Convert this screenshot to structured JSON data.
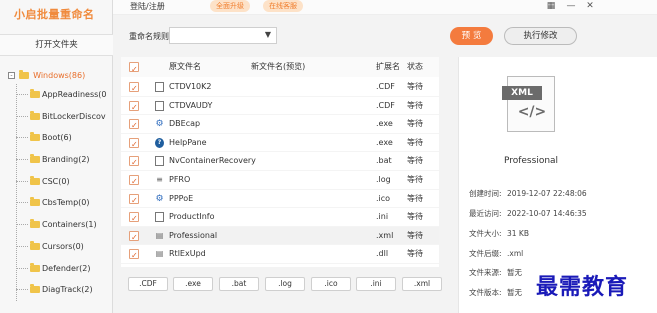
{
  "app": {
    "logo_text": "小启批量重命名",
    "login": "登陆/注册",
    "pills": [
      "全面升级",
      "在线客服"
    ]
  },
  "window_controls": {
    "grid": "▦",
    "minimize": "—",
    "close": "✕"
  },
  "sidebar": {
    "open_folder": "打开文件夹",
    "root": {
      "toggle": "-",
      "label": "Windows(86)"
    },
    "items": [
      "AppReadiness(0",
      "BitLockerDiscov",
      "Boot(6)",
      "Branding(2)",
      "CSC(0)",
      "CbsTemp(0)",
      "Containers(1)",
      "Cursors(0)",
      "Defender(2)",
      "DiagTrack(2)"
    ]
  },
  "toolbar": {
    "rule_label": "重命名规则",
    "rule_value": "",
    "rule_chevron": "▼",
    "preview_label": "预 览",
    "execute_label": "执行修改"
  },
  "table": {
    "headers": {
      "original": "原文件名",
      "new": "新文件名(预览)",
      "ext": "扩展名",
      "status": "状态"
    },
    "rows": [
      {
        "icon": "document-icon",
        "glyph": "",
        "name": "CTDV10K2",
        "new": "",
        "ext": ".CDF",
        "status": "等待",
        "selected": false
      },
      {
        "icon": "document-icon",
        "glyph": "",
        "name": "CTDVAUDY",
        "new": "",
        "ext": ".CDF",
        "status": "等待",
        "selected": false
      },
      {
        "icon": "gear-icon",
        "glyph": "⚙",
        "name": "DBEcap",
        "new": "",
        "ext": ".exe",
        "status": "等待",
        "selected": false
      },
      {
        "icon": "help-icon",
        "glyph": "?",
        "name": "HelpPane",
        "new": "",
        "ext": ".exe",
        "status": "等待",
        "selected": false
      },
      {
        "icon": "document-icon",
        "glyph": "",
        "name": "NvContainerRecovery",
        "new": "",
        "ext": ".bat",
        "status": "等待",
        "selected": false
      },
      {
        "icon": "text-file-icon",
        "glyph": "≡",
        "name": "PFRO",
        "new": "",
        "ext": ".log",
        "status": "等待",
        "selected": false
      },
      {
        "icon": "network-icon",
        "glyph": "⚙",
        "name": "PPPoE",
        "new": "",
        "ext": ".ico",
        "status": "等待",
        "selected": false
      },
      {
        "icon": "document-icon",
        "glyph": "",
        "name": "ProductInfo",
        "new": "",
        "ext": ".ini",
        "status": "等待",
        "selected": false
      },
      {
        "icon": "xml-file-icon",
        "glyph": "▤",
        "name": "Professional",
        "new": "",
        "ext": ".xml",
        "status": "等待",
        "selected": true
      },
      {
        "icon": "dll-file-icon",
        "glyph": "▤",
        "name": "RtlExUpd",
        "new": "",
        "ext": ".dll",
        "status": "等待",
        "selected": false
      }
    ]
  },
  "ext_chips": [
    ".CDF",
    ".exe",
    ".bat",
    ".log",
    ".ico",
    ".ini",
    ".xml"
  ],
  "details": {
    "icon_tag": "XML",
    "icon_code": "</>",
    "name": "Professional",
    "fields": [
      {
        "k": "创建时间:",
        "v": "2019-12-07 22:48:06"
      },
      {
        "k": "最近访问:",
        "v": "2022-10-07 14:46:35"
      },
      {
        "k": "文件大小:",
        "v": "31 KB"
      },
      {
        "k": "文件后缀:",
        "v": ".xml"
      },
      {
        "k": "文件来源:",
        "v": "暂无"
      },
      {
        "k": "文件版本:",
        "v": "暂无"
      }
    ]
  },
  "watermark": "最需教育"
}
